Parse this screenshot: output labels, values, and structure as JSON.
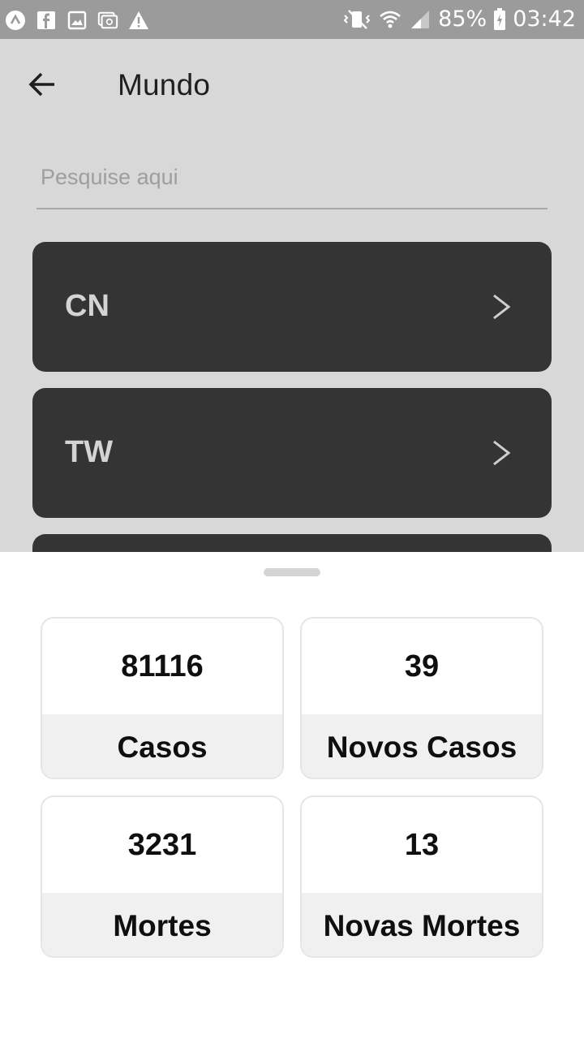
{
  "status_bar": {
    "left_icons": [
      "app-icon",
      "facebook-icon",
      "gallery-icon",
      "email-icon",
      "warning-icon"
    ],
    "right_icons": [
      "vibrate-icon",
      "wifi-icon",
      "signal-icon"
    ],
    "battery_percent": "85%",
    "time": "03:42"
  },
  "header": {
    "title": "Mundo"
  },
  "search": {
    "placeholder": "Pesquise aqui",
    "value": ""
  },
  "countries": [
    {
      "code": "CN"
    },
    {
      "code": "TW"
    }
  ],
  "stats": {
    "cases": {
      "value": "81116",
      "label": "Casos"
    },
    "new_cases": {
      "value": "39",
      "label": "Novos Casos"
    },
    "deaths": {
      "value": "3231",
      "label": "Mortes"
    },
    "new_deaths": {
      "value": "13",
      "label": "Novas Mortes"
    }
  },
  "colors": {
    "overlay_background": "#d8d8d8",
    "list_item": "#343434",
    "sheet": "#ffffff",
    "caption_background": "#f0f0f0"
  }
}
